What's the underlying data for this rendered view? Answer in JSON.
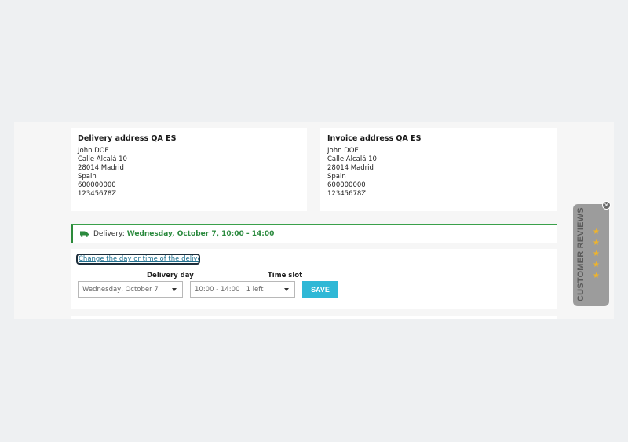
{
  "delivery_address": {
    "title": "Delivery address QA ES",
    "lines": [
      "John DOE",
      "Calle Alcalá 10",
      "28014 Madrid",
      "Spain",
      "600000000",
      "12345678Z"
    ]
  },
  "invoice_address": {
    "title": "Invoice address QA ES",
    "lines": [
      "John DOE",
      "Calle Alcalá 10",
      "28014 Madrid",
      "Spain",
      "600000000",
      "12345678Z"
    ]
  },
  "delivery_banner": {
    "label": "Delivery:",
    "value": "Wednesday, October 7, 10:00 - 14:00",
    "icon": "truck-icon",
    "accent": "#2b8a3e"
  },
  "change_form": {
    "link_text": "Change the day or time of the delivery",
    "delivery_day_label": "Delivery day",
    "delivery_day_value": "Wednesday, October 7",
    "time_slot_label": "Time slot",
    "time_slot_value": "10:00 - 14:00  ·  1 left",
    "save_label": "SAVE",
    "save_color": "#2fb8d6"
  },
  "reviews_widget": {
    "label": "CUSTOMER REVIEWS",
    "stars": [
      "★",
      "★",
      "★",
      "★",
      "★"
    ],
    "close": "✕"
  }
}
